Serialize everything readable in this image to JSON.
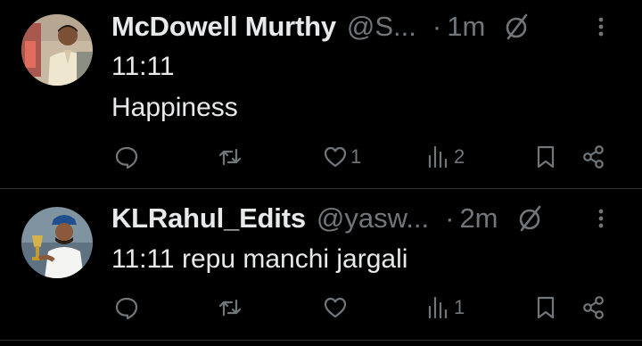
{
  "tweets": [
    {
      "display_name": "McDowell Murthy",
      "handle": "@S...",
      "separator": "·",
      "time": "1m",
      "text_lines": [
        "11:11",
        "Happiness"
      ],
      "actions": {
        "reply_count": "",
        "repost_count": "",
        "like_count": "1",
        "views_count": "2"
      }
    },
    {
      "display_name": "KLRahul_Edits",
      "handle": "@yasw...",
      "separator": "·",
      "time": "2m",
      "text_lines": [
        "11:11 repu manchi jargali"
      ],
      "actions": {
        "reply_count": "",
        "repost_count": "",
        "like_count": "",
        "views_count": "1"
      }
    }
  ],
  "icons": {
    "reply": "reply-icon",
    "repost": "repost-icon",
    "like": "heart-icon",
    "views": "views-icon",
    "bookmark": "bookmark-icon",
    "share": "share-icon",
    "muted": "muted-icon",
    "more": "more-icon"
  },
  "colors": {
    "background": "#000000",
    "primary_text": "#e7e9ea",
    "secondary_text": "#71767b",
    "divider": "#2f3336"
  }
}
